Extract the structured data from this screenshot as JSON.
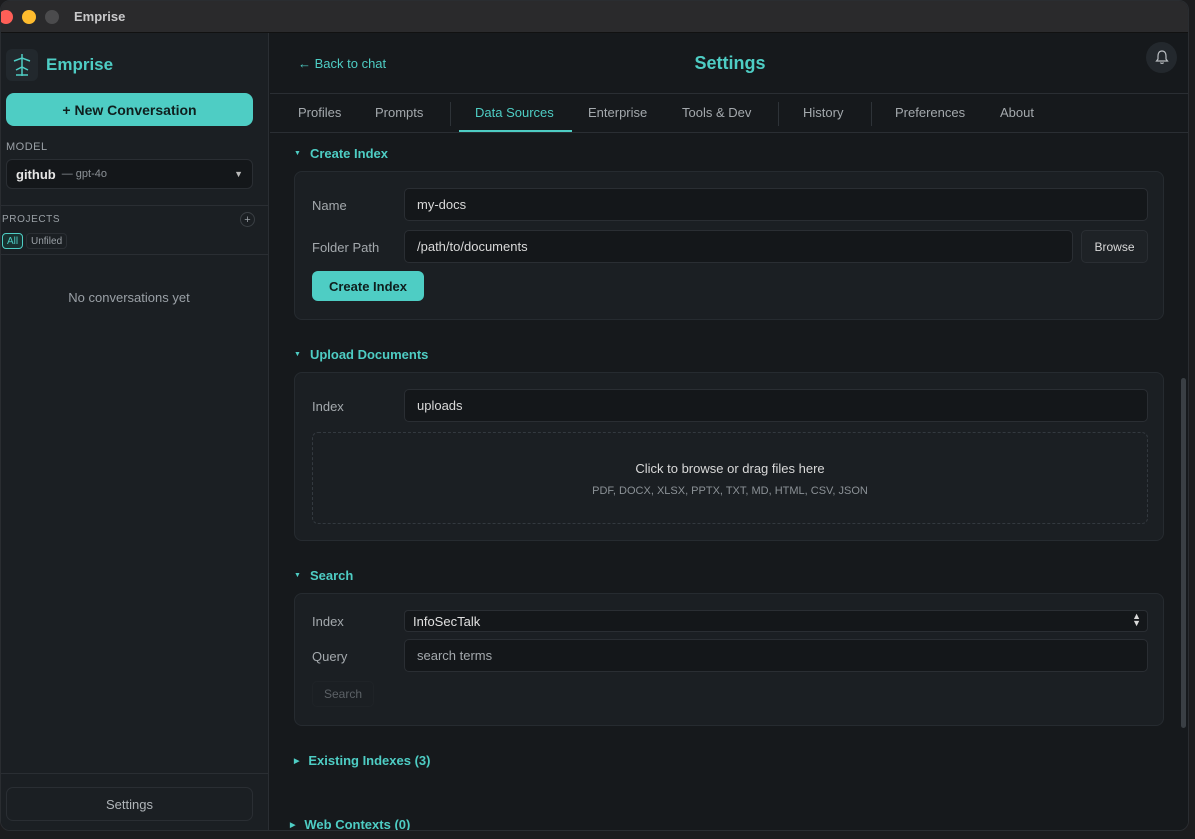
{
  "window": {
    "title": "Emprise"
  },
  "sidebar": {
    "brand_name": "Emprise",
    "new_conversation": "+ New Conversation",
    "model_label": "MODEL",
    "model_provider": "github",
    "model_name": "— gpt-4o",
    "projects_label": "PROJECTS",
    "projects_add": "+",
    "filters": [
      "All",
      "Unfiled"
    ],
    "empty_text": "No conversations yet",
    "settings_label": "Settings"
  },
  "header": {
    "back_link": "← Back to chat",
    "title": "Settings"
  },
  "tabs": [
    {
      "label": "Profiles"
    },
    {
      "label": "Prompts"
    },
    {
      "label": "Data Sources",
      "active": true
    },
    {
      "label": "Enterprise"
    },
    {
      "label": "Tools & Dev"
    },
    {
      "label": "History"
    },
    {
      "label": "Preferences"
    },
    {
      "label": "About"
    }
  ],
  "create_index": {
    "heading": "Create Index",
    "name_label": "Name",
    "name_value": "my-docs",
    "folder_label": "Folder Path",
    "folder_placeholder": "/path/to/documents",
    "browse_label": "Browse",
    "create_label": "Create Index"
  },
  "upload": {
    "heading": "Upload Documents",
    "index_label": "Index",
    "index_value": "uploads",
    "dropzone_text": "Click to browse or drag files here",
    "dropzone_types": "PDF, DOCX, XLSX, PPTX, TXT, MD, HTML, CSV, JSON"
  },
  "search": {
    "heading": "Search",
    "index_label": "Index",
    "index_selected": "InfoSecTalk",
    "query_label": "Query",
    "query_placeholder": "search terms",
    "search_label": "Search"
  },
  "collapsed_sections": {
    "existing_indexes": "Existing Indexes (3)",
    "web_contexts": "Web Contexts (0)"
  },
  "colors": {
    "accent": "#4ecdc4",
    "background": "#16191c",
    "sidebar": "#1b1f23"
  }
}
